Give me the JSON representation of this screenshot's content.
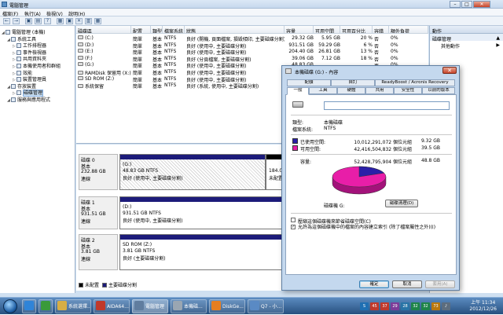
{
  "window": {
    "title": "電腦管理",
    "min": "–",
    "max": "□",
    "close": "✕"
  },
  "menu": [
    "檔案(F)",
    "執行(A)",
    "檢視(V)",
    "說明(H)"
  ],
  "toolbar": [
    "←",
    "→",
    "▣",
    "▤",
    "?",
    "▦",
    "▣",
    "✕",
    "▥",
    "▦"
  ],
  "tree": [
    {
      "label": "電腦管理 (本機)",
      "icon": "computer-icon",
      "indent": 0
    },
    {
      "label": "系統工具",
      "icon": "tools-icon",
      "indent": 1
    },
    {
      "label": "工作排程器",
      "icon": "scheduler-icon",
      "indent": 2
    },
    {
      "label": "事件檢視器",
      "icon": "event-icon",
      "indent": 2
    },
    {
      "label": "共用資料夾",
      "icon": "folder-icon",
      "indent": 2
    },
    {
      "label": "本機使用者和群組",
      "icon": "users-icon",
      "indent": 2
    },
    {
      "label": "效能",
      "icon": "performance-icon",
      "indent": 2
    },
    {
      "label": "裝置管理員",
      "icon": "device-icon",
      "indent": 2
    },
    {
      "label": "存放裝置",
      "icon": "storage-icon",
      "indent": 1
    },
    {
      "label": "磁碟管理",
      "icon": "disk-icon",
      "indent": 2,
      "selected": true
    },
    {
      "label": "服務與應用程式",
      "icon": "services-icon",
      "indent": 1
    }
  ],
  "grid": {
    "headers": [
      "磁碟區",
      "配置",
      "類型",
      "檔案系統",
      "狀態",
      "容量",
      "可用空間",
      "可用百分比",
      "容錯",
      "額外負荷"
    ],
    "rows": [
      [
        "(C:)",
        "簡單",
        "基本",
        "NTFS",
        "良好 (開機, 頁面檔案, 損毀傾印, 主要磁碟分割)",
        "29.32 GB",
        "5.95 GB",
        "20 %",
        "否",
        "0%"
      ],
      [
        "(D:)",
        "簡單",
        "基本",
        "NTFS",
        "良好 (使用中, 主要磁碟分割)",
        "931.51 GB",
        "59.29 GB",
        "6 %",
        "否",
        "0%"
      ],
      [
        "(E:)",
        "簡單",
        "基本",
        "NTFS",
        "良好 (使用中, 主要磁碟分割)",
        "204.40 GB",
        "26.81 GB",
        "13 %",
        "否",
        "0%"
      ],
      [
        "(F:)",
        "簡單",
        "基本",
        "NTFS",
        "良好 (分頁檔案, 主要磁碟分割)",
        "39.06 GB",
        "7.12 GB",
        "18 %",
        "否",
        "0%"
      ],
      [
        "(G:)",
        "簡單",
        "基本",
        "NTFS",
        "良好 (使用中, 主要磁碟分割)",
        "48.83 GB",
        "",
        "",
        "否",
        "0%"
      ],
      [
        "RAMDisk 保留用 (X:)",
        "簡單",
        "基本",
        "NTFS",
        "良好 (使用中, 主要磁碟分割)",
        "399 MB",
        "",
        "",
        "否",
        "0%"
      ],
      [
        "SD ROM (Z:)",
        "簡單",
        "基本",
        "NTFS",
        "良好 (使用中, 主要磁碟分割)",
        "3.81 GB",
        "",
        "",
        "否",
        "0%"
      ],
      [
        "系統保留",
        "簡單",
        "基本",
        "NTFS",
        "良好 (系統, 使用中, 主要磁碟分割)",
        "101 MB",
        "",
        "",
        "否",
        "0%"
      ]
    ]
  },
  "disks": [
    {
      "name": "磁碟 0",
      "type": "基本",
      "size": "232.88 GB",
      "status": "連線",
      "parts": [
        {
          "title": "(G:)",
          "size": "48.83 GB NTFS",
          "status": "良好 (使用中, 主要磁碟分割)",
          "hatch": true
        },
        {
          "title": "",
          "size": "184.06 GB",
          "status": "未配置",
          "unalloc": true
        }
      ]
    },
    {
      "name": "磁碟 1",
      "type": "基本",
      "size": "931.51 GB",
      "status": "連線",
      "parts": [
        {
          "title": "(D:)",
          "size": "931.51 GB NTFS",
          "status": "良好 (使用中, 主要磁碟分割)"
        }
      ]
    },
    {
      "name": "磁碟 2",
      "type": "基本",
      "size": "3.81 GB",
      "status": "連線",
      "parts": [
        {
          "title": "SD ROM  (Z:)",
          "size": "3.81 GB NTFS",
          "status": "良好 (主要磁碟分割)"
        }
      ]
    }
  ],
  "legend": [
    {
      "label": "未配置",
      "color": "#000000"
    },
    {
      "label": "主要磁碟分割",
      "color": "#1c1b7a"
    }
  ],
  "actions": {
    "title": "動作",
    "section": "磁碟管理",
    "item": "其他動作"
  },
  "dialog": {
    "title": "本機磁碟 (G:) - 內容",
    "close": "✕",
    "tabs_top": [
      "配額",
      "自訂",
      "ReadyBoost / Acronis Recovery"
    ],
    "tabs_bottom": [
      "一般",
      "工具",
      "硬體",
      "共用",
      "安全性",
      "以前的版本"
    ],
    "name_value": "",
    "type_label": "類型:",
    "type_value": "本機磁碟",
    "fs_label": "檔案系統:",
    "fs_value": "NTFS",
    "used_label": "已使用空間:",
    "used_bytes": "10,012,291,072 個位元組",
    "used_gb": "9.32 GB",
    "free_label": "可用空間:",
    "free_bytes": "42,416,504,832 個位元組",
    "free_gb": "39.5 GB",
    "cap_label": "容量:",
    "cap_bytes": "52,428,795,904 個位元組",
    "cap_gb": "48.8 GB",
    "used_fraction": 0.19,
    "drive_label": "磁碟機 G:",
    "cleanup": "磁碟清理(D)",
    "chk1": "壓縮這個磁碟機來節省磁碟空間(C)",
    "chk2": "允許為這個磁碟機中的檔案的內容建立索引 (除了檔案屬性之外)(I)",
    "chk1_checked": false,
    "chk2_checked": true,
    "ok": "確定",
    "cancel": "取消",
    "apply": "套用(A)",
    "used_color": "#2a1fa8",
    "free_color": "#e81ea8"
  },
  "taskbar": {
    "apps": [
      {
        "label": "",
        "icon": "ie-icon",
        "color": "#2f84d8"
      },
      {
        "label": "",
        "icon": "chrome-icon",
        "color": "#3a9a3a"
      },
      {
        "label": "系統選擇...",
        "icon": "folder-icon",
        "color": "#d6ae45"
      },
      {
        "label": "AIDA64...",
        "icon": "aida-icon",
        "color": "#c0392b"
      },
      {
        "label": "電腦管理",
        "icon": "computer-mgmt-icon",
        "color": "#607d9f",
        "active": true
      },
      {
        "label": "本機磁...",
        "icon": "drive-icon",
        "color": "#9aa6b2"
      },
      {
        "label": "DiskGe...",
        "icon": "diskgenius-icon",
        "color": "#e67e22"
      },
      {
        "label": "Q7 - 小...",
        "icon": "app-icon",
        "color": "#5a8ac4"
      }
    ],
    "tray": [
      {
        "t": "S",
        "c": "#1f6fb2"
      },
      {
        "t": "45",
        "c": "#c0392b"
      },
      {
        "t": "37",
        "c": "#c0392b"
      },
      {
        "t": "29",
        "c": "#7d3c98"
      },
      {
        "t": "28",
        "c": "#2874a6"
      },
      {
        "t": "32",
        "c": "#1e8449"
      },
      {
        "t": "32",
        "c": "#1e8449"
      },
      {
        "t": "73",
        "c": "#b9770e"
      },
      {
        "t": "♪",
        "c": "#5d6d7e"
      }
    ],
    "time": "上午 11:34",
    "date": "2012/12/26"
  }
}
